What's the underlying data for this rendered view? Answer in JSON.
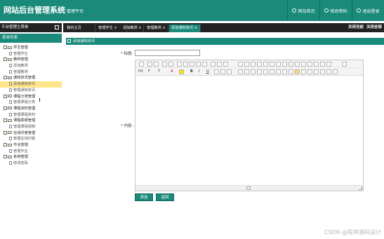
{
  "header": {
    "title": "网站后台管理系统",
    "subtitle": "管理平台",
    "buttons": [
      {
        "label": "网站首页",
        "icon": "home-icon"
      },
      {
        "label": "修改密码",
        "icon": "key-icon"
      },
      {
        "label": "退出登录",
        "icon": "power-icon"
      }
    ]
  },
  "sidebar": {
    "top_label": "平台管理主菜单",
    "section_label": "菜单列表",
    "tree": [
      {
        "label": "学生管理",
        "level": 1
      },
      {
        "label": "管理学生",
        "level": 2
      },
      {
        "label": "教师管理",
        "level": 1
      },
      {
        "label": "添加教师",
        "level": 2
      },
      {
        "label": "管理教师",
        "level": 2
      },
      {
        "label": "通知资讯管理",
        "level": 1
      },
      {
        "label": "添加通知资讯",
        "level": 2,
        "selected": true
      },
      {
        "label": "管理通知资讯",
        "level": 2
      },
      {
        "label": "课程分类管理",
        "level": 1
      },
      {
        "label": "管理课程分类",
        "level": 2
      },
      {
        "label": "课程资料管理",
        "level": 1
      },
      {
        "label": "管理课程资料",
        "level": 2
      },
      {
        "label": "课程视频管理",
        "level": 1
      },
      {
        "label": "管理课程视频",
        "level": 2
      },
      {
        "label": "在线问答管理",
        "level": 1
      },
      {
        "label": "管理在线问答",
        "level": 2
      },
      {
        "label": "作业管理",
        "level": 1
      },
      {
        "label": "管理作业",
        "level": 2
      },
      {
        "label": "系统管理",
        "level": 1
      },
      {
        "label": "修改密码",
        "level": 2
      }
    ]
  },
  "tabs": {
    "items": [
      {
        "label": "我的主页",
        "closable": false
      },
      {
        "label": "管理学生",
        "closable": true
      },
      {
        "label": "添加教师",
        "closable": true
      },
      {
        "label": "管理教师",
        "closable": true
      },
      {
        "label": "添加通知资讯",
        "closable": true,
        "active": true
      }
    ],
    "close_current": "关闭当前",
    "close_all": "关闭全部"
  },
  "form": {
    "panel_title": "添加通知资讯",
    "title_label": "标题:",
    "title_value": "",
    "content_label": "内容:",
    "required_mark": "*",
    "submit_label": "添加",
    "back_label": "返回"
  },
  "editor": {
    "heading_label": "H1",
    "font_family_label": "F",
    "font_size_label": "T",
    "font_color_label": "A",
    "bold": "B",
    "italic": "I",
    "underline": "U"
  },
  "watermark": "CSDN @程序源码设计",
  "colors": {
    "accent": "#1a8a7a",
    "dark_bar": "#222222",
    "selected_row": "#ffe58a"
  }
}
